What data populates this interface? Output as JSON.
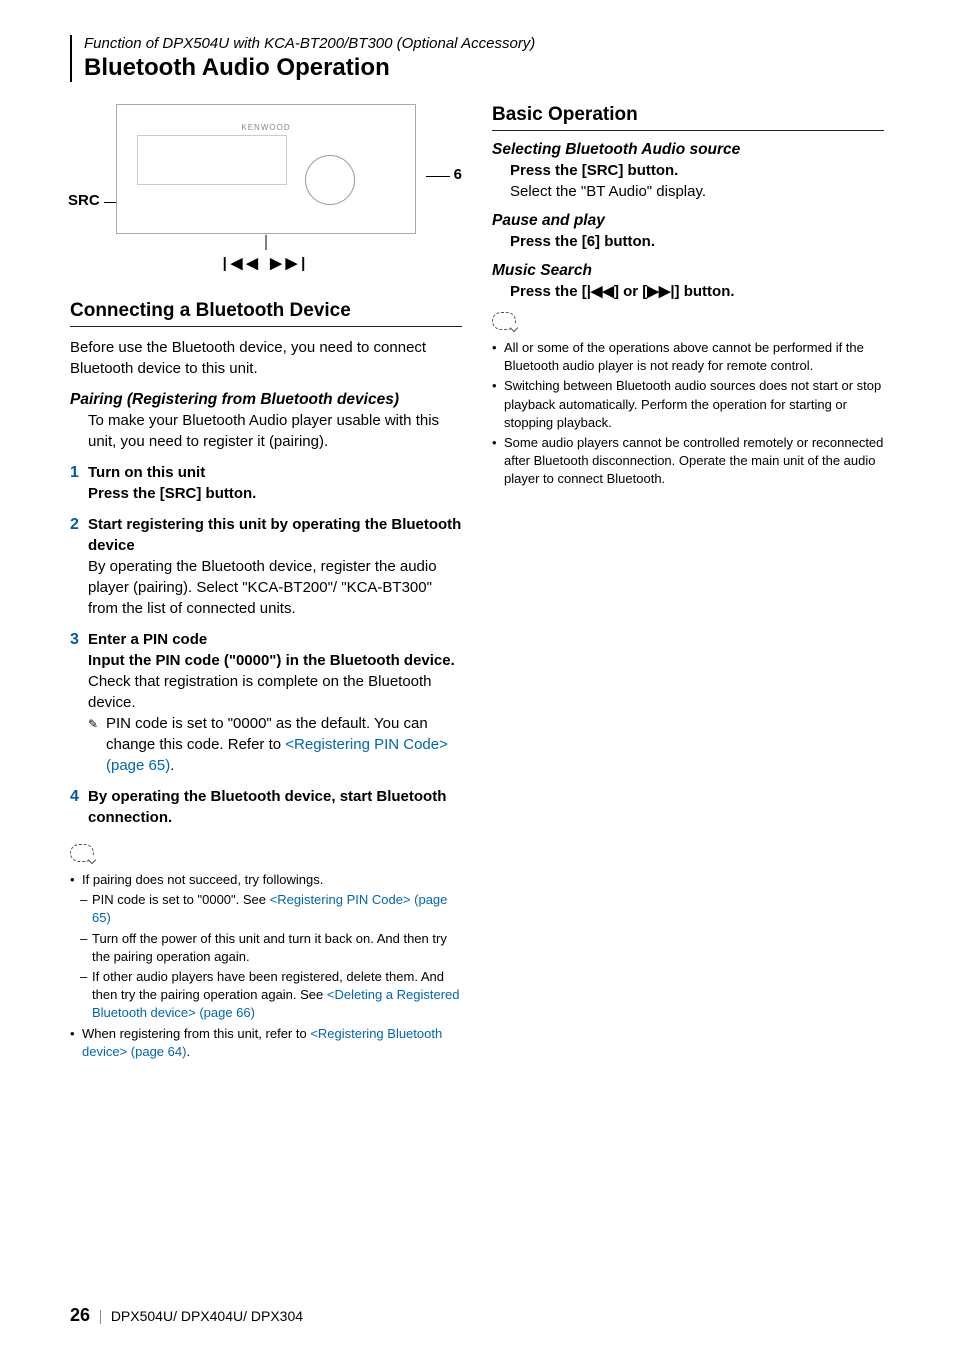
{
  "header": {
    "function_line": "Function of DPX504U with KCA-BT200/BT300 (Optional Accessory)",
    "main_title": "Bluetooth Audio Operation"
  },
  "image": {
    "label_6": "6",
    "label_src": "SRC",
    "brand": "KENWOOD",
    "track_icons": "|◀◀  ▶▶|"
  },
  "left": {
    "section1_title": "Connecting a Bluetooth Device",
    "intro": "Before use the Bluetooth device, you need to connect Bluetooth device to this unit.",
    "pairing_heading": "Pairing (Registering from Bluetooth devices)",
    "pairing_body": "To make your Bluetooth Audio player usable with this unit, you need to register it (pairing).",
    "steps": [
      {
        "num": "1",
        "bold1": "Turn on this unit",
        "bold2": "Press the [SRC] button."
      },
      {
        "num": "2",
        "bold1": "Start registering this unit by operating the Bluetooth device",
        "body": "By operating the Bluetooth device, register the audio player (pairing). Select \"KCA-BT200\"/ \"KCA-BT300\" from the list of connected units."
      },
      {
        "num": "3",
        "bold1": "Enter a PIN code",
        "bold2": "Input the PIN code (\"0000\") in the Bluetooth device.",
        "body": "Check that registration is complete on the Bluetooth device.",
        "pencil_text_pre": "PIN code is set to \"0000\" as the default. You can change this code. Refer to ",
        "pencil_link": "<Registering PIN Code> (page 65)",
        "pencil_text_post": "."
      },
      {
        "num": "4",
        "bold1": "By operating the Bluetooth device, start Bluetooth connection."
      }
    ],
    "notes": {
      "n1": "If pairing does not succeed, try followings.",
      "d1_pre": "PIN code is set to \"0000\". See ",
      "d1_link": "<Registering PIN Code> (page 65)",
      "d2": "Turn off the power of this unit and turn it back on. And then try the pairing operation again.",
      "d3_pre": "If other audio players have been registered, delete them. And then try the pairing operation again.  See ",
      "d3_link": "<Deleting a Registered Bluetooth device> (page 66)",
      "n2_pre": "When registering from this unit, refer to ",
      "n2_link": "<Registering Bluetooth device> (page 64)",
      "n2_post": "."
    }
  },
  "right": {
    "section_title": "Basic Operation",
    "a1_heading": "Selecting Bluetooth Audio source",
    "a1_bold": "Press the [SRC] button.",
    "a1_body": "Select the \"BT Audio\" display.",
    "a2_heading": "Pause and play",
    "a2_bold": "Press the [6] button.",
    "a3_heading": "Music Search",
    "a3_bold": "Press the [|◀◀] or [▶▶|] button.",
    "notes": [
      "All or some of the operations above cannot be performed if the Bluetooth audio player is not ready for remote control.",
      "Switching between Bluetooth audio sources does not start or stop playback automatically. Perform the operation for starting or stopping playback.",
      "Some audio players cannot be controlled remotely or reconnected after Bluetooth disconnection. Operate the main unit of the audio player to connect Bluetooth."
    ]
  },
  "footer": {
    "page": "26",
    "models": "DPX504U/ DPX404U/ DPX304"
  }
}
